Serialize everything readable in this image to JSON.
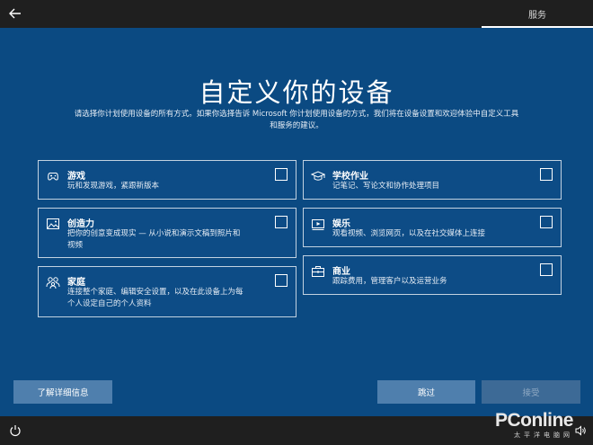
{
  "header": {
    "tab_label": "服务"
  },
  "page": {
    "title": "自定义你的设备",
    "subtitle_line1": "请选择你计划使用设备的所有方式。如果你选择告诉 Microsoft 你计划使用设备的方式，我们将在设备设置和欢迎体验中自定义工具",
    "subtitle_line2": "和服务的建议。"
  },
  "options": [
    {
      "title": "游戏",
      "desc1": "玩和发现游戏，紧跟新版本",
      "desc2": "",
      "icon": "gamepad-icon",
      "checked": false
    },
    {
      "title": "学校作业",
      "desc1": "记笔记、写论文和协作处理项目",
      "desc2": "",
      "icon": "graduation-cap-icon",
      "checked": false
    },
    {
      "title": "创造力",
      "desc1": "把你的创意变成现实 — 从小说和演示文稿到照片和",
      "desc2": "视频",
      "icon": "image-icon",
      "checked": false
    },
    {
      "title": "娱乐",
      "desc1": "观看视频、浏览网页，以及在社交媒体上连接",
      "desc2": "",
      "icon": "video-icon",
      "checked": false
    },
    {
      "title": "家庭",
      "desc1": "连接整个家庭、编辑安全设置，以及在此设备上为每",
      "desc2": "个人设定自己的个人资料",
      "icon": "family-icon",
      "checked": false
    },
    {
      "title": "商业",
      "desc1": "跟踪费用，管理客户以及运营业务",
      "desc2": "",
      "icon": "briefcase-icon",
      "checked": false
    }
  ],
  "buttons": {
    "learn_more": "了解详细信息",
    "skip": "跳过",
    "accept": "接受"
  },
  "watermark": {
    "logo": "PConline",
    "sub": "太平洋电脑网"
  },
  "colors": {
    "background": "#0b4a82",
    "bar": "#1f1f1f",
    "button": "#4f7fad",
    "button_disabled": "#3d6a96"
  }
}
